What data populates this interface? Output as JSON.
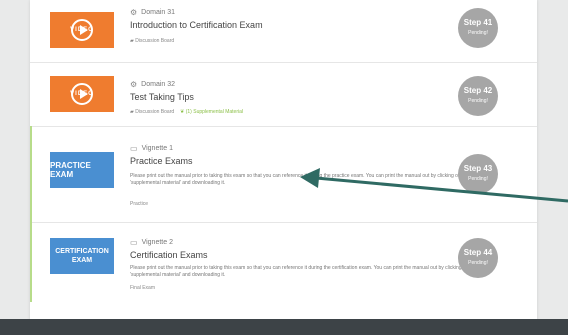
{
  "items": [
    {
      "kind": "video",
      "thumb_label": "VIDEO",
      "meta": "Domain 31",
      "title": "Introduction to Certification Exam",
      "link1": "Discussion Board",
      "step": "Step 41",
      "status": "Pending!"
    },
    {
      "kind": "video",
      "thumb_label": "VIDEO",
      "meta": "Domain 32",
      "title": "Test Taking Tips",
      "link1": "Discussion Board",
      "link2": "(1) Supplemental Material",
      "step": "Step 42",
      "status": "Pending!"
    },
    {
      "kind": "practice",
      "thumb_label": "PRACTICE EXAM",
      "meta": "Vignette 1",
      "title": "Practice Exams",
      "desc": "Please print out the manual prior to taking this exam so that you can reference it during the practice exam. You can print the manual out by clicking on 'supplemental material' and downloading it.",
      "small": "Practice",
      "step": "Step 43",
      "status": "Pending!"
    },
    {
      "kind": "cert",
      "thumb_label_line1": "CERTIFICATION",
      "thumb_label_line2": "EXAM",
      "meta": "Vignette 2",
      "title": "Certification Exams",
      "desc": "Please print out the manual prior to taking this exam so that you can reference it during the certification exam. You can print the manual out by clicking on 'supplemental material' and downloading it.",
      "small": "Final Exam",
      "step": "Step 44",
      "status": "Pending!"
    }
  ],
  "colors": {
    "video": "#ef7c2f",
    "exam": "#4a8fd1",
    "step": "#a6a6a6",
    "arrow": "#2f6a63",
    "accent": "#b7dc8a"
  }
}
